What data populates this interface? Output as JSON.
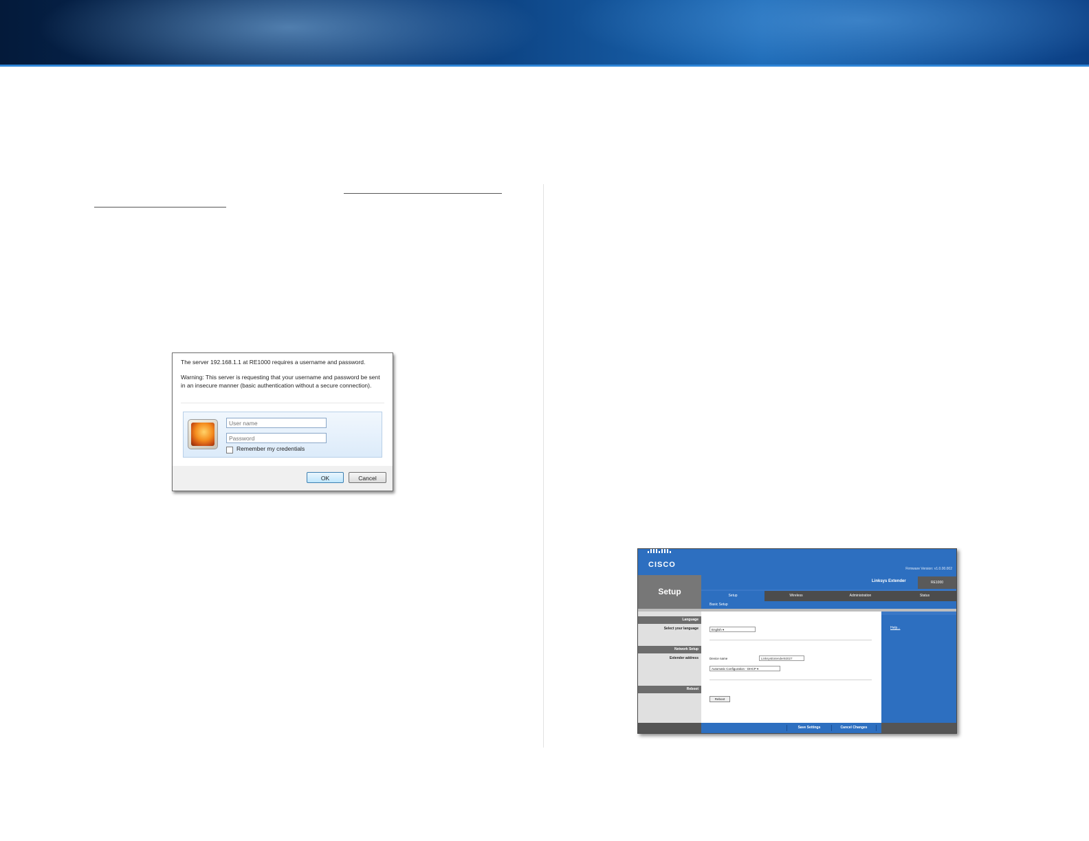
{
  "login_dialog": {
    "message": "The server 192.168.1.1 at RE1000 requires a username and password.",
    "warning": "Warning: This server is requesting that your username and password be sent in an insecure manner (basic authentication without a secure connection).",
    "username_placeholder": "User name",
    "password_placeholder": "Password",
    "remember_label": "Remember my credentials",
    "ok_label": "OK",
    "cancel_label": "Cancel"
  },
  "router_ui": {
    "brand": "CISCO",
    "firmware_version": "Firmware Version: v1.0.00.002",
    "page_title": "Setup",
    "product_name": "Linksys Extender",
    "product_model": "RE1000",
    "tabs": [
      "Setup",
      "Wireless",
      "Administration",
      "Status"
    ],
    "active_tab": "Setup",
    "subtab": "Basic Setup",
    "sections": {
      "language": "Language",
      "select_language": "Select your language",
      "language_value": "English",
      "network_setup": "Network Setup",
      "extender_address": "Extender address",
      "device_name_label": "Device name",
      "device_name_value": "LinksysExtender92027",
      "config_value": "Automatic Configuration - DHCP",
      "reboot": "Reboot",
      "reboot_button": "Reboot"
    },
    "help_link": "Help...",
    "save_button": "Save Settings",
    "cancel_button": "Cancel Changes"
  }
}
